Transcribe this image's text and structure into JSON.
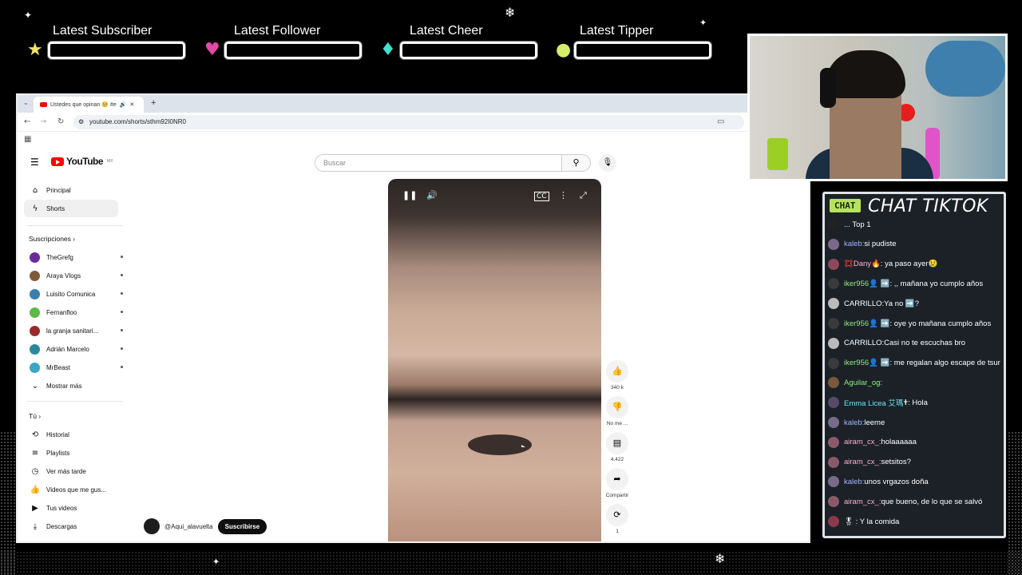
{
  "alerts": [
    {
      "label": "Latest Subscriber",
      "icon": "star",
      "color": "#f3e46b"
    },
    {
      "label": "Latest Follower",
      "icon": "heart",
      "color": "#e24aa6"
    },
    {
      "label": "Latest Cheer",
      "icon": "gem",
      "color": "#3fe0d0"
    },
    {
      "label": "Latest Tipper",
      "icon": "coin",
      "color": "#d6ee6a"
    }
  ],
  "browser": {
    "tab_title": "Ustedes que opinan 🥺 #e",
    "new_tab": "+",
    "url": "youtube.com/shorts/sthm92I0NR0"
  },
  "youtube": {
    "logo": "YouTube",
    "region": "MX",
    "search_placeholder": "Buscar",
    "nav": [
      {
        "label": "Principal",
        "icon": "home-icon"
      },
      {
        "label": "Shorts",
        "icon": "shorts-icon"
      }
    ],
    "subs_heading": "Suscripciones",
    "subscriptions": [
      {
        "label": "TheGrefg",
        "color": "#6b2a9a"
      },
      {
        "label": "Araya Vlogs",
        "color": "#7d5a3a"
      },
      {
        "label": "Luisito Comunica",
        "color": "#3a7fb0"
      },
      {
        "label": "Fernanfloo",
        "color": "#5cb84a"
      },
      {
        "label": "la granja sanitari...",
        "color": "#9a2a2a"
      },
      {
        "label": "Adrián Marcelo",
        "color": "#2a8a9a"
      },
      {
        "label": "MrBeast",
        "color": "#3aa6c8"
      }
    ],
    "show_more": "Mostrar más",
    "you_heading": "Tú",
    "you_items": [
      {
        "label": "Historial",
        "icon": "history-icon"
      },
      {
        "label": "Playlists",
        "icon": "playlist-icon"
      },
      {
        "label": "Ver más tarde",
        "icon": "clock-icon"
      },
      {
        "label": "Videos que me gus...",
        "icon": "like-icon"
      },
      {
        "label": "Tus videos",
        "icon": "video-icon"
      },
      {
        "label": "Descargas",
        "icon": "download-icon"
      }
    ],
    "actions": [
      {
        "icon": "like-icon",
        "label": "340 k"
      },
      {
        "icon": "dislike-icon",
        "label": "No me ..."
      },
      {
        "icon": "comment-icon",
        "label": "4.422"
      },
      {
        "icon": "share-icon",
        "label": "Compartir"
      },
      {
        "icon": "remix-icon",
        "label": "1"
      }
    ],
    "channel": "@Aqui_alavuelta",
    "subscribe": "Suscribirse"
  },
  "chat": {
    "tag": "CHAT",
    "title": "CHAT TIKTOK",
    "messages": [
      {
        "user": "",
        "text": "... Top 1",
        "color": "#ffffff",
        "av": "#222"
      },
      {
        "user": "kaleb:",
        "text": " si pudiste",
        "color": "#9fb4ff",
        "av": "#7a6a8a"
      },
      {
        "user": "💢Dany",
        "text": "🔥: ya paso ayer😢",
        "color": "#ffb0c8",
        "av": "#8a4a5a"
      },
      {
        "user": "iker956",
        "text": " 👤 ➡️: ,, mañana yo cumplo años",
        "color": "#8bf07a",
        "av": "#3a3a3a"
      },
      {
        "user": "CARRILLO:",
        "text": " Ya no ➡️?",
        "color": "#ffffff",
        "av": "#bbb"
      },
      {
        "user": "iker956",
        "text": " 👤 ➡️: oye yo mañana cumplo años",
        "color": "#8bf07a",
        "av": "#3a3a3a"
      },
      {
        "user": "CARRILLO:",
        "text": " Casi no te escuchas bro",
        "color": "#ffffff",
        "av": "#bbb"
      },
      {
        "user": "iker956",
        "text": " 👤 ➡️: me regalan algo escape de tsur",
        "color": "#8bf07a",
        "av": "#3a3a3a"
      },
      {
        "user": "Aguilar_og:",
        "text": "",
        "color": "#8bf07a",
        "av": "#7a5a3a"
      },
      {
        "user": "Emma Licea 艾瑪",
        "text": " 🕇: Hola",
        "color": "#6ee0f0",
        "av": "#5a4a6a"
      },
      {
        "user": "kaleb:",
        "text": " leeme",
        "color": "#9fb4ff",
        "av": "#7a6a8a"
      },
      {
        "user": "airam_cx_:",
        "text": " holaaaaaa",
        "color": "#ffb0c8",
        "av": "#8a5a6a"
      },
      {
        "user": "airam_cx_:",
        "text": " setsitos?",
        "color": "#ffb0c8",
        "av": "#8a5a6a"
      },
      {
        "user": "kaleb:",
        "text": " unos vrgazos doña",
        "color": "#9fb4ff",
        "av": "#7a6a8a"
      },
      {
        "user": "airam_cx_:",
        "text": " que bueno, de lo que se salvó",
        "color": "#ffb0c8",
        "av": "#8a5a6a"
      },
      {
        "user": "",
        "text": "🎖 : Y la comida",
        "color": "#ffffff",
        "av": "#8a3a4a"
      }
    ]
  }
}
